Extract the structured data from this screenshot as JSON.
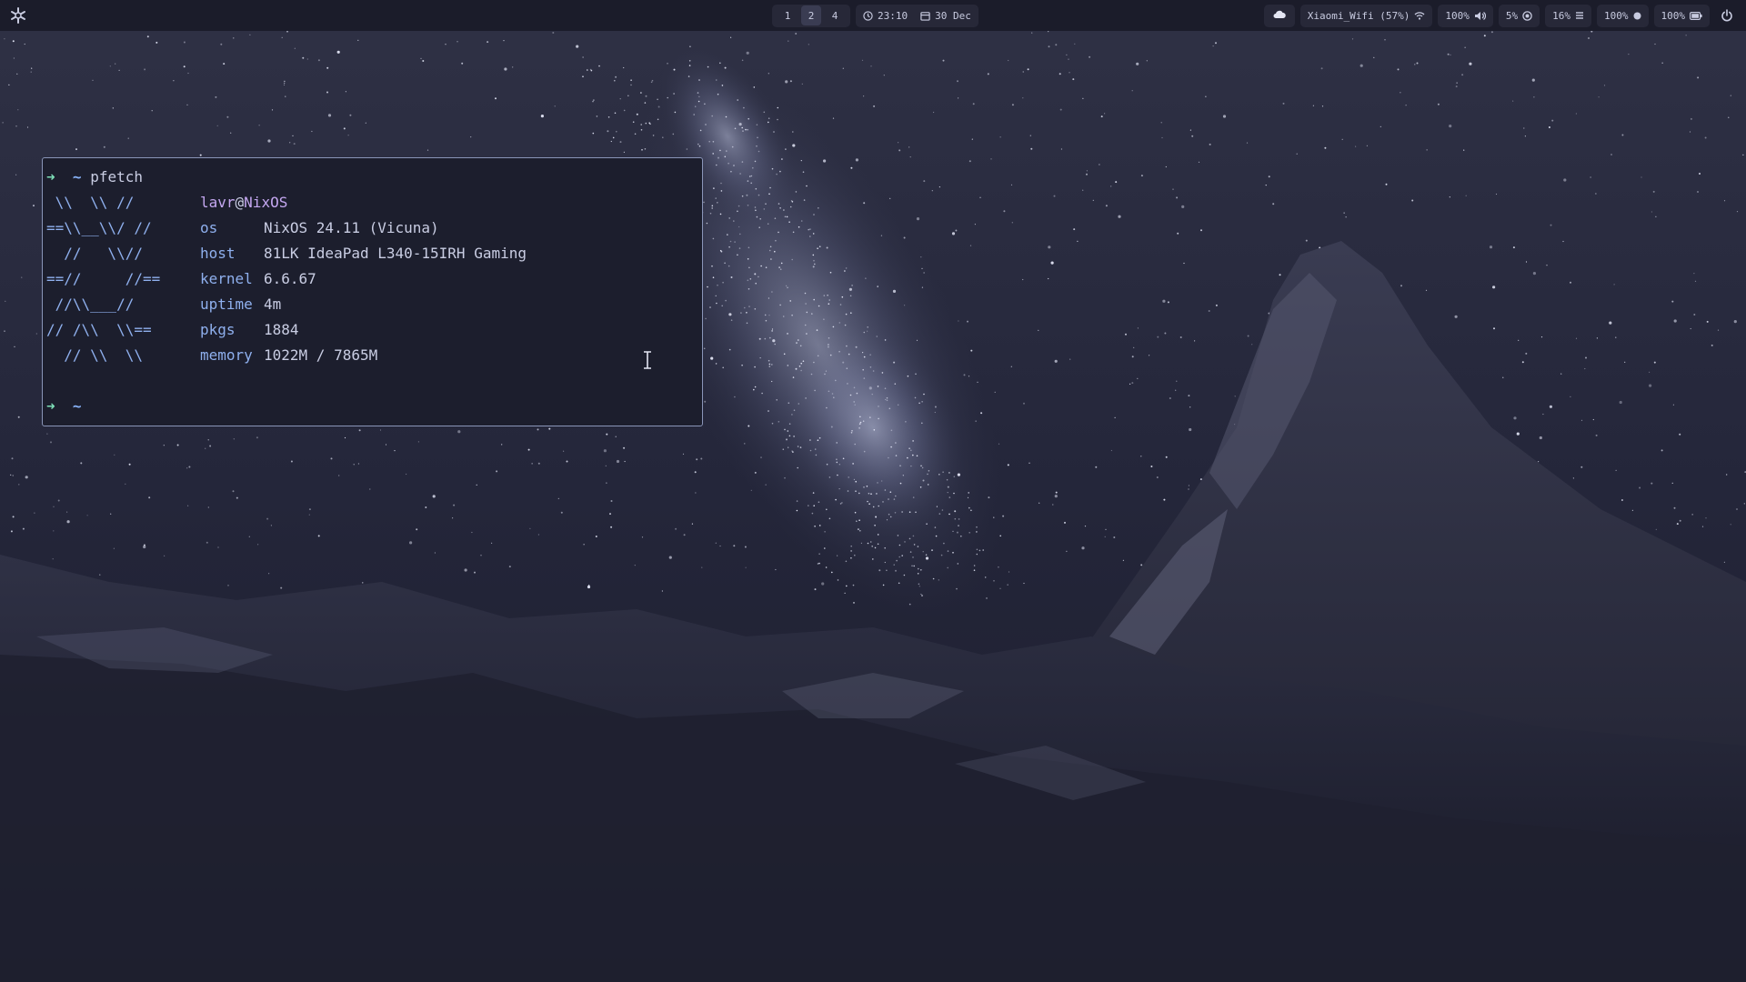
{
  "topbar": {
    "launcher_icon": "nix-snowflake-icon",
    "workspaces": [
      "1",
      "2",
      "4"
    ],
    "active_workspace": "2",
    "time": "23:10",
    "date": "30 Dec",
    "clock_icon": "clock-icon",
    "calendar_icon": "calendar-icon",
    "tray_icon": "cloud-icon",
    "wifi": {
      "label": "Xiaomi_Wifi (57%)",
      "icon": "wifi-icon"
    },
    "volume": {
      "label": "100%",
      "icon": "speaker-icon"
    },
    "cpu": {
      "label": "5%",
      "icon": "cpu-icon"
    },
    "memory": {
      "label": "16%",
      "icon": "memory-icon"
    },
    "brightness": {
      "label": "100%",
      "icon": "brightness-icon"
    },
    "battery": {
      "label": "100%",
      "icon": "battery-icon"
    },
    "power_icon": "power-icon"
  },
  "terminal": {
    "prompt_arrow": "➜",
    "prompt_dir": "~",
    "command": "pfetch",
    "ascii": [
      " \\\\  \\\\ //",
      "==\\\\__\\\\/ //",
      "  //   \\\\//",
      "==//     //==",
      " //\\\\___//",
      "// /\\\\  \\\\==",
      "  // \\\\  \\\\"
    ],
    "user": "lavr",
    "at": "@",
    "host": "NixOS",
    "info": [
      {
        "label": "os",
        "value": "NixOS 24.11 (Vicuna)"
      },
      {
        "label": "host",
        "value": "81LK IdeaPad L340-15IRH Gaming"
      },
      {
        "label": "kernel",
        "value": "6.6.67"
      },
      {
        "label": "uptime",
        "value": "4m"
      },
      {
        "label": "pkgs",
        "value": "1884"
      },
      {
        "label": "memory",
        "value": "1022M / 7865M"
      }
    ]
  },
  "colors": {
    "bar_bg": "#1b1c2a",
    "pill_bg": "#272838",
    "terminal_bg": "#1c1e2d",
    "terminal_border": "#8a95b8",
    "prompt_green": "#7ee0b8",
    "accent_blue": "#8fb0ee",
    "accent_purple": "#c4a7f0"
  }
}
